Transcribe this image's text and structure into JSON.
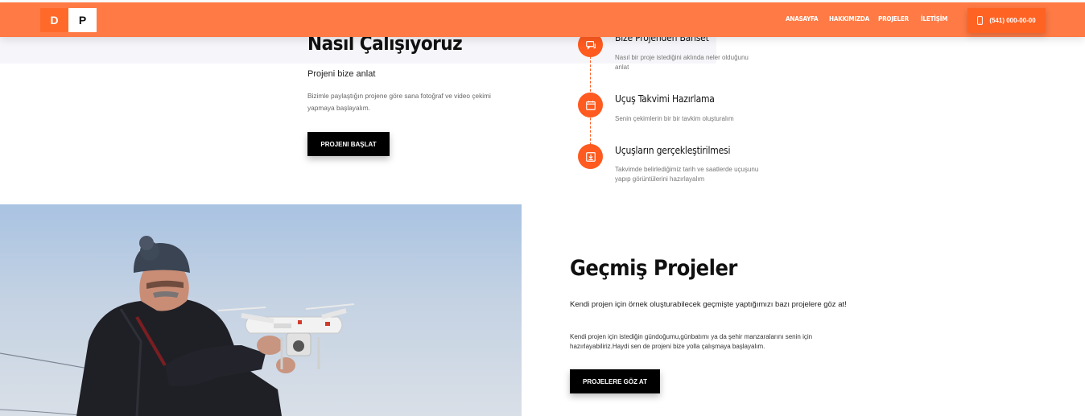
{
  "colors": {
    "accent": "#ff7a45",
    "accent_dark": "#ff5a1f",
    "button_dark": "#000000"
  },
  "header": {
    "logo": [
      "D",
      "P"
    ],
    "nav": [
      "ANASAYFA",
      "HAKKIMIZDA",
      "PROJELER",
      "İLETİŞİM"
    ],
    "phone": "(541) 000-00-00",
    "phone_icon": "mobile-phone-icon"
  },
  "how_we_work": {
    "title": "Nasıl Çalışıyoruz",
    "subtitle": "Projeni bize anlat",
    "text": "Bizimle paylaştığın projene göre sana fotoğraf ve video çekimi yapmaya başlayalım.",
    "button": "PROJENI BAŞLAT",
    "steps": [
      {
        "icon": "chat-icon",
        "title": "Bize Projenden Bahset",
        "desc": "Nasıl bir proje istediğini aklında neler olduğunu anlat"
      },
      {
        "icon": "calendar-icon",
        "title": "Uçuş Takvimi Hazırlama",
        "desc": "Senin çekimlerin bir bir tavkim oluşturalım"
      },
      {
        "icon": "download-icon",
        "title": "Uçuşların gerçekleştirilmesi",
        "desc": "Takvimde belirlediğimiz tarih ve saatlerde uçuşunu yapıp görüntülerini hazırlayalım"
      }
    ]
  },
  "past_projects": {
    "title": "Geçmiş Projeler",
    "subtitle": "Kendi projen için örnek oluşturabilecek geçmişte yaptığımızı bazı projelere göz at!",
    "text": "Kendi projen için istediğin gündoğumu,günbatımı ya da şehir manzaralarını senin için hazırlayabiliriz.Haydi sen de projeni bize yolla çalışmaya başlayalım.",
    "button": "PROJELERE GÖZ AT"
  }
}
